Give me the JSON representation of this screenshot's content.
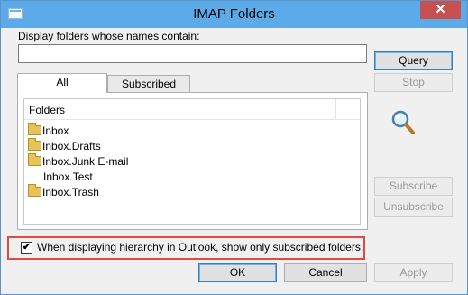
{
  "window": {
    "title": "IMAP Folders",
    "close_glyph": "✕"
  },
  "search": {
    "label": "Display folders whose names contain:",
    "value": ""
  },
  "buttons": {
    "query": "Query",
    "stop": "Stop",
    "subscribe": "Subscribe",
    "unsubscribe": "Unsubscribe",
    "ok": "OK",
    "cancel": "Cancel",
    "apply": "Apply"
  },
  "tabs": [
    {
      "label": "All",
      "active": true
    },
    {
      "label": "Subscribed",
      "active": false
    }
  ],
  "folder_list": {
    "column_header": "Folders",
    "items": [
      {
        "label": "Inbox",
        "icon": "folder-icon"
      },
      {
        "label": "Inbox.Drafts",
        "icon": "folder-icon"
      },
      {
        "label": "Inbox.Junk E-mail",
        "icon": "folder-icon"
      },
      {
        "label": "Inbox.Test",
        "icon": ""
      },
      {
        "label": "Inbox.Trash",
        "icon": "folder-icon"
      }
    ]
  },
  "option": {
    "checked": true,
    "check_glyph": "✔",
    "label": "When displaying hierarchy in Outlook, show only subscribed folders."
  },
  "colors": {
    "titlebar": "#5cabe8",
    "close": "#c75050",
    "highlight": "#e04a3f"
  }
}
